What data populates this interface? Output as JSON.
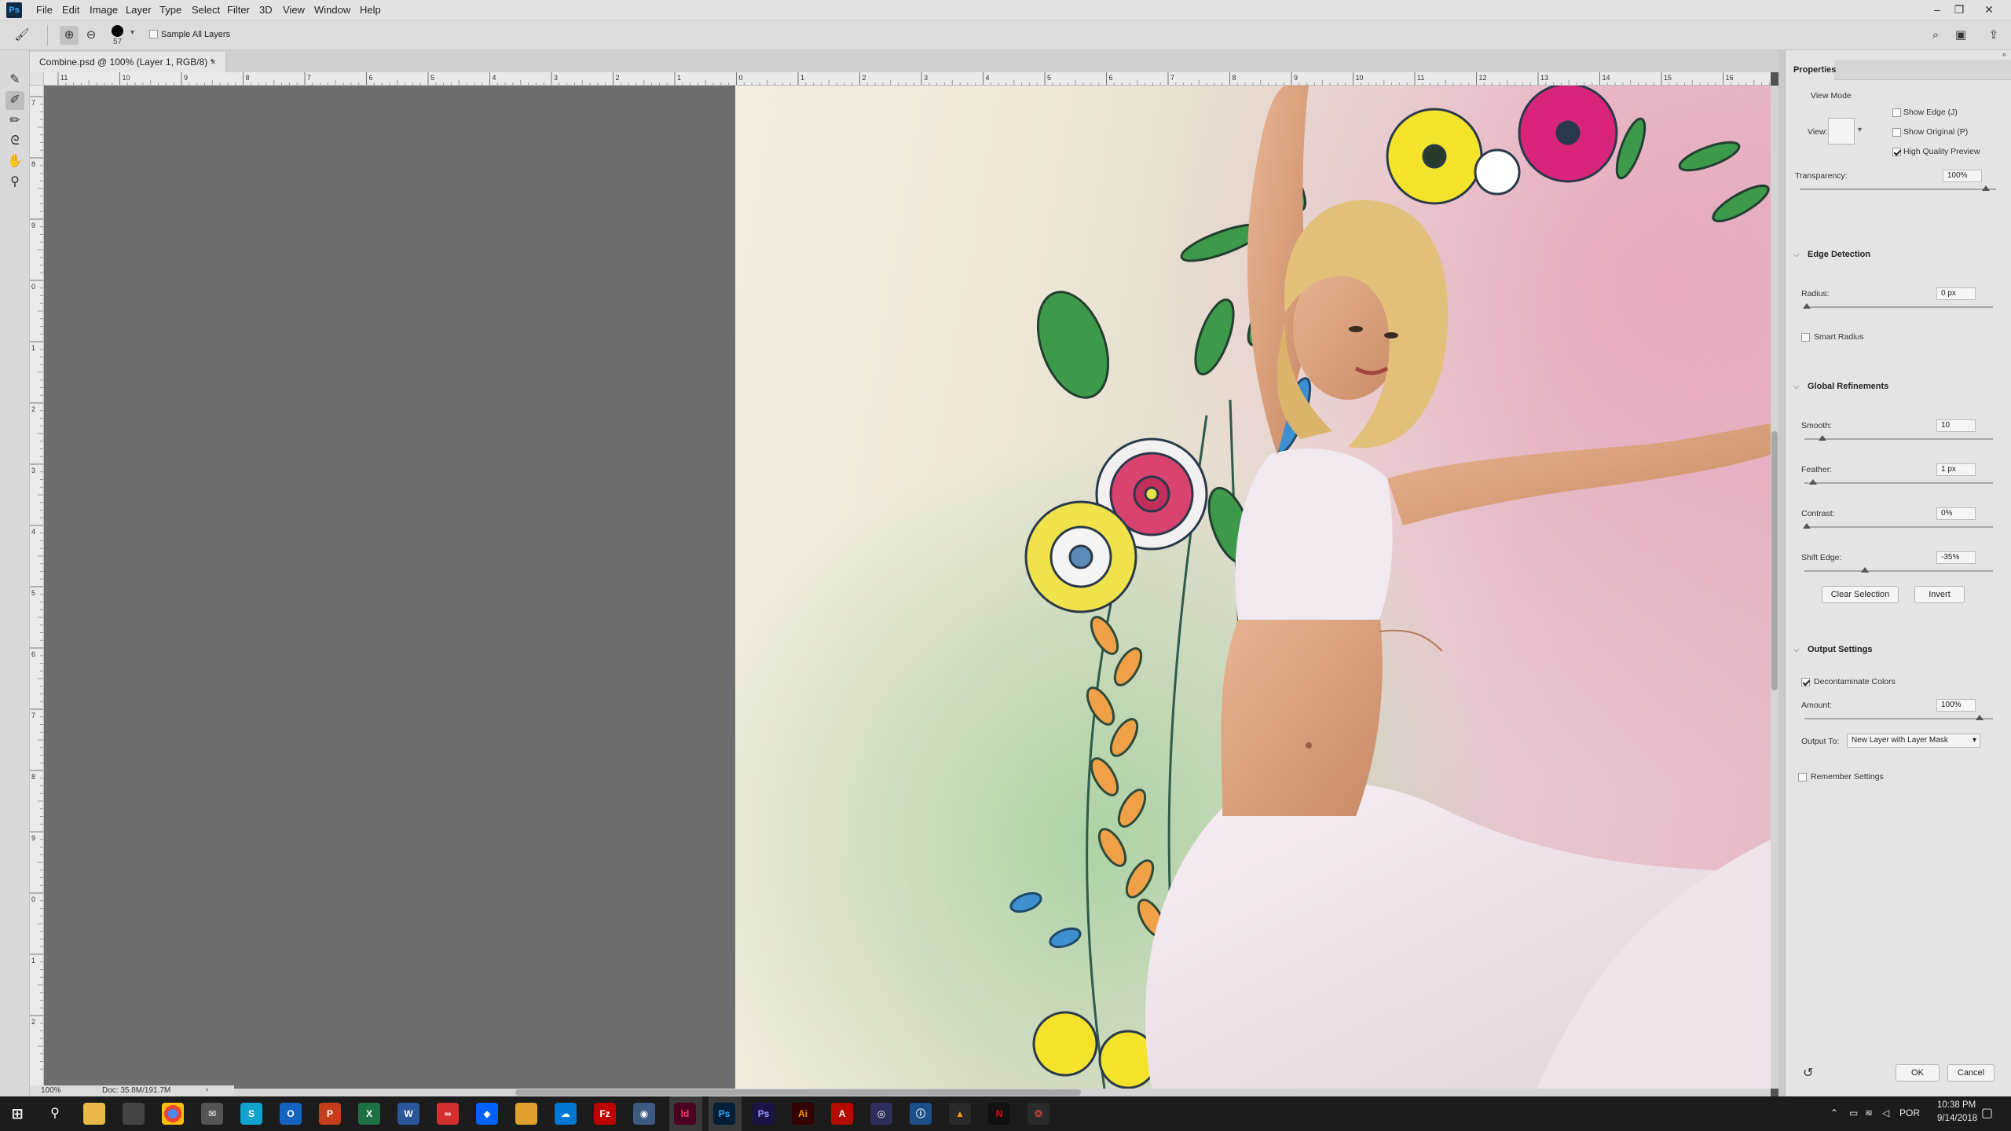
{
  "app": {
    "logo": "Ps"
  },
  "menu": [
    "File",
    "Edit",
    "Image",
    "Layer",
    "Type",
    "Select",
    "Filter",
    "3D",
    "View",
    "Window",
    "Help"
  ],
  "options_bar": {
    "brush_size": "57",
    "sample_all_layers": "Sample All Layers"
  },
  "document": {
    "tab_title": "Combine.psd @ 100% (Layer 1, RGB/8) *",
    "close": "×"
  },
  "ruler": {
    "h_ticks": [
      "11",
      "10",
      "9",
      "8",
      "7",
      "6",
      "5",
      "4",
      "3",
      "2",
      "1",
      "0",
      "1",
      "2",
      "3",
      "4",
      "5",
      "6",
      "7",
      "8",
      "9",
      "10",
      "11",
      "12",
      "13",
      "14",
      "15",
      "16"
    ],
    "v_ticks": [
      "7",
      "8",
      "9",
      "0",
      "1",
      "2",
      "3",
      "4",
      "5",
      "6",
      "7",
      "8",
      "9",
      "0",
      "1",
      "2"
    ]
  },
  "status": {
    "zoom": "100%",
    "doc": "Doc: 35.8M/191.7M",
    "arrow": "›"
  },
  "properties": {
    "tab": "Properties",
    "view_mode": "View Mode",
    "view_label": "View:",
    "show_edge": "Show Edge (J)",
    "show_original": "Show Original (P)",
    "high_quality_preview": "High Quality Preview",
    "transparency_label": "Transparency:",
    "transparency": "100%",
    "edge_detection": "Edge Detection",
    "radius_label": "Radius:",
    "radius": "0 px",
    "smart_radius": "Smart Radius",
    "global_refinements": "Global Refinements",
    "smooth_label": "Smooth:",
    "smooth": "10",
    "feather_label": "Feather:",
    "feather": "1 px",
    "contrast_label": "Contrast:",
    "contrast": "0%",
    "shift_edge_label": "Shift Edge:",
    "shift_edge": "-35%",
    "clear_selection": "Clear Selection",
    "invert": "Invert",
    "output_settings": "Output Settings",
    "decontaminate": "Decontaminate Colors",
    "amount_label": "Amount:",
    "amount": "100%",
    "output_to_label": "Output To:",
    "output_to": "New Layer with Layer Mask",
    "remember": "Remember Settings",
    "ok": "OK",
    "cancel": "Cancel"
  },
  "taskbar": {
    "apps": [
      "Id",
      "Ps",
      "Ps",
      "Ai"
    ],
    "lang": "POR",
    "time": "10:38 PM",
    "date": "9/14/2018"
  }
}
